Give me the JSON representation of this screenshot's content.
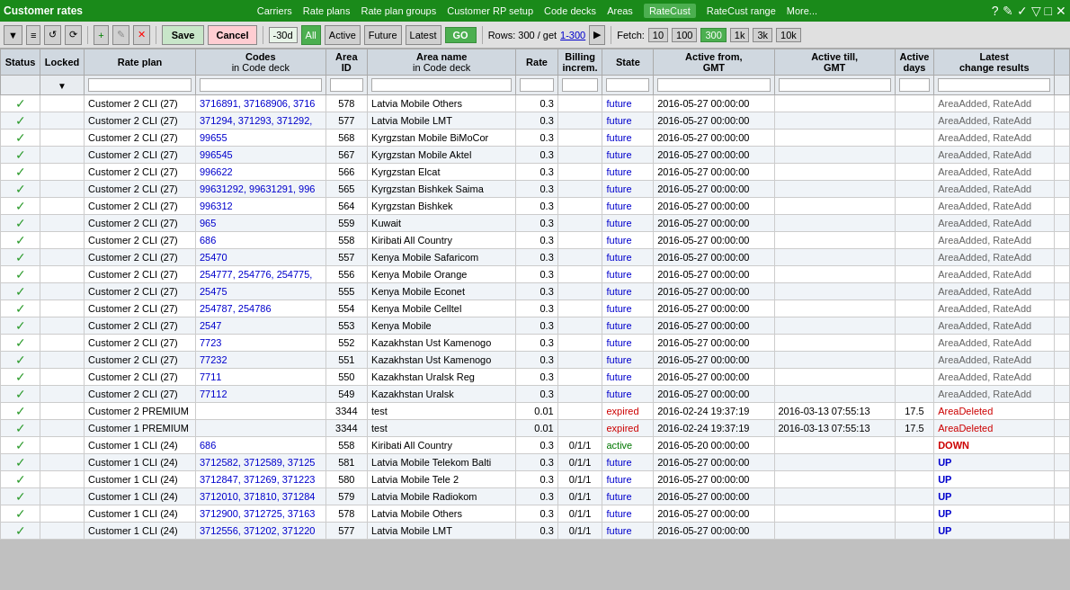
{
  "title": "Customer rates",
  "nav": {
    "items": [
      {
        "label": "Carriers",
        "active": false
      },
      {
        "label": "Rate plans",
        "active": false
      },
      {
        "label": "Rate plan groups",
        "active": false
      },
      {
        "label": "Customer RP setup",
        "active": false
      },
      {
        "label": "Code decks",
        "active": false
      },
      {
        "label": "Areas",
        "active": false
      },
      {
        "label": "RateCust",
        "active": true
      },
      {
        "label": "RateCust range",
        "active": false
      },
      {
        "label": "More...",
        "active": false
      }
    ]
  },
  "toolbar": {
    "save_label": "Save",
    "cancel_label": "Cancel",
    "go_label": "GO",
    "date_filter": "-30d",
    "filter_all": "All",
    "filter_active": "Active",
    "filter_future": "Future",
    "filter_latest": "Latest",
    "rows_info": "Rows: 300 / get",
    "rows_range": "1-300",
    "fetch_label": "Fetch:",
    "fetch_options": [
      "10",
      "100",
      "300",
      "1k",
      "3k",
      "10k"
    ],
    "fetch_active": "300"
  },
  "columns": [
    {
      "label": "Status",
      "sub": ""
    },
    {
      "label": "Locked",
      "sub": ""
    },
    {
      "label": "Rate plan",
      "sub": ""
    },
    {
      "label": "Codes",
      "sub": "in Code deck"
    },
    {
      "label": "Area\nID",
      "sub": ""
    },
    {
      "label": "Area name",
      "sub": "in Code deck"
    },
    {
      "label": "Rate",
      "sub": ""
    },
    {
      "label": "Billing\nincrem.",
      "sub": ""
    },
    {
      "label": "State",
      "sub": ""
    },
    {
      "label": "Active from,\nGMT",
      "sub": ""
    },
    {
      "label": "Active till,\nGMT",
      "sub": ""
    },
    {
      "label": "Active\ndays",
      "sub": ""
    },
    {
      "label": "Latest\nchange results",
      "sub": ""
    }
  ],
  "rows": [
    {
      "status": "✓",
      "locked": "",
      "rateplan": "Customer 2 CLI (27)",
      "codes": "3716891, 37168906, 3716",
      "area_id": "578",
      "area_name": "Latvia Mobile Others",
      "rate": "0.3",
      "billing": "",
      "state": "future",
      "active_from": "2016-05-27 00:00:00",
      "active_till": "",
      "days": "",
      "latest": "AreaAdded, RateAdd"
    },
    {
      "status": "✓",
      "locked": "",
      "rateplan": "Customer 2 CLI (27)",
      "codes": "371294, 371293, 371292,",
      "area_id": "577",
      "area_name": "Latvia Mobile LMT",
      "rate": "0.3",
      "billing": "",
      "state": "future",
      "active_from": "2016-05-27 00:00:00",
      "active_till": "",
      "days": "",
      "latest": "AreaAdded, RateAdd"
    },
    {
      "status": "✓",
      "locked": "",
      "rateplan": "Customer 2 CLI (27)",
      "codes": "99655",
      "area_id": "568",
      "area_name": "Kyrgzstan Mobile BiMoCor",
      "rate": "0.3",
      "billing": "",
      "state": "future",
      "active_from": "2016-05-27 00:00:00",
      "active_till": "",
      "days": "",
      "latest": "AreaAdded, RateAdd"
    },
    {
      "status": "✓",
      "locked": "",
      "rateplan": "Customer 2 CLI (27)",
      "codes": "996545",
      "area_id": "567",
      "area_name": "Kyrgzstan Mobile Aktel",
      "rate": "0.3",
      "billing": "",
      "state": "future",
      "active_from": "2016-05-27 00:00:00",
      "active_till": "",
      "days": "",
      "latest": "AreaAdded, RateAdd"
    },
    {
      "status": "✓",
      "locked": "",
      "rateplan": "Customer 2 CLI (27)",
      "codes": "996622",
      "area_id": "566",
      "area_name": "Kyrgzstan Elcat",
      "rate": "0.3",
      "billing": "",
      "state": "future",
      "active_from": "2016-05-27 00:00:00",
      "active_till": "",
      "days": "",
      "latest": "AreaAdded, RateAdd"
    },
    {
      "status": "✓",
      "locked": "",
      "rateplan": "Customer 2 CLI (27)",
      "codes": "99631292, 99631291, 996",
      "area_id": "565",
      "area_name": "Kyrgzstan Bishkek Saima",
      "rate": "0.3",
      "billing": "",
      "state": "future",
      "active_from": "2016-05-27 00:00:00",
      "active_till": "",
      "days": "",
      "latest": "AreaAdded, RateAdd"
    },
    {
      "status": "✓",
      "locked": "",
      "rateplan": "Customer 2 CLI (27)",
      "codes": "996312",
      "area_id": "564",
      "area_name": "Kyrgzstan Bishkek",
      "rate": "0.3",
      "billing": "",
      "state": "future",
      "active_from": "2016-05-27 00:00:00",
      "active_till": "",
      "days": "",
      "latest": "AreaAdded, RateAdd"
    },
    {
      "status": "✓",
      "locked": "",
      "rateplan": "Customer 2 CLI (27)",
      "codes": "965",
      "area_id": "559",
      "area_name": "Kuwait",
      "rate": "0.3",
      "billing": "",
      "state": "future",
      "active_from": "2016-05-27 00:00:00",
      "active_till": "",
      "days": "",
      "latest": "AreaAdded, RateAdd"
    },
    {
      "status": "✓",
      "locked": "",
      "rateplan": "Customer 2 CLI (27)",
      "codes": "686",
      "area_id": "558",
      "area_name": "Kiribati All Country",
      "rate": "0.3",
      "billing": "",
      "state": "future",
      "active_from": "2016-05-27 00:00:00",
      "active_till": "",
      "days": "",
      "latest": "AreaAdded, RateAdd"
    },
    {
      "status": "✓",
      "locked": "",
      "rateplan": "Customer 2 CLI (27)",
      "codes": "25470",
      "area_id": "557",
      "area_name": "Kenya Mobile Safaricom",
      "rate": "0.3",
      "billing": "",
      "state": "future",
      "active_from": "2016-05-27 00:00:00",
      "active_till": "",
      "days": "",
      "latest": "AreaAdded, RateAdd"
    },
    {
      "status": "✓",
      "locked": "",
      "rateplan": "Customer 2 CLI (27)",
      "codes": "254777, 254776, 254775,",
      "area_id": "556",
      "area_name": "Kenya Mobile Orange",
      "rate": "0.3",
      "billing": "",
      "state": "future",
      "active_from": "2016-05-27 00:00:00",
      "active_till": "",
      "days": "",
      "latest": "AreaAdded, RateAdd"
    },
    {
      "status": "✓",
      "locked": "",
      "rateplan": "Customer 2 CLI (27)",
      "codes": "25475",
      "area_id": "555",
      "area_name": "Kenya Mobile Econet",
      "rate": "0.3",
      "billing": "",
      "state": "future",
      "active_from": "2016-05-27 00:00:00",
      "active_till": "",
      "days": "",
      "latest": "AreaAdded, RateAdd"
    },
    {
      "status": "✓",
      "locked": "",
      "rateplan": "Customer 2 CLI (27)",
      "codes": "254787, 254786",
      "area_id": "554",
      "area_name": "Kenya Mobile Celltel",
      "rate": "0.3",
      "billing": "",
      "state": "future",
      "active_from": "2016-05-27 00:00:00",
      "active_till": "",
      "days": "",
      "latest": "AreaAdded, RateAdd"
    },
    {
      "status": "✓",
      "locked": "",
      "rateplan": "Customer 2 CLI (27)",
      "codes": "2547",
      "area_id": "553",
      "area_name": "Kenya Mobile",
      "rate": "0.3",
      "billing": "",
      "state": "future",
      "active_from": "2016-05-27 00:00:00",
      "active_till": "",
      "days": "",
      "latest": "AreaAdded, RateAdd"
    },
    {
      "status": "✓",
      "locked": "",
      "rateplan": "Customer 2 CLI (27)",
      "codes": "7723",
      "area_id": "552",
      "area_name": "Kazakhstan Ust Kamenogo",
      "rate": "0.3",
      "billing": "",
      "state": "future",
      "active_from": "2016-05-27 00:00:00",
      "active_till": "",
      "days": "",
      "latest": "AreaAdded, RateAdd"
    },
    {
      "status": "✓",
      "locked": "",
      "rateplan": "Customer 2 CLI (27)",
      "codes": "77232",
      "area_id": "551",
      "area_name": "Kazakhstan Ust Kamenogo",
      "rate": "0.3",
      "billing": "",
      "state": "future",
      "active_from": "2016-05-27 00:00:00",
      "active_till": "",
      "days": "",
      "latest": "AreaAdded, RateAdd"
    },
    {
      "status": "✓",
      "locked": "",
      "rateplan": "Customer 2 CLI (27)",
      "codes": "7711",
      "area_id": "550",
      "area_name": "Kazakhstan Uralsk Reg",
      "rate": "0.3",
      "billing": "",
      "state": "future",
      "active_from": "2016-05-27 00:00:00",
      "active_till": "",
      "days": "",
      "latest": "AreaAdded, RateAdd"
    },
    {
      "status": "✓",
      "locked": "",
      "rateplan": "Customer 2 CLI (27)",
      "codes": "77112",
      "area_id": "549",
      "area_name": "Kazakhstan Uralsk",
      "rate": "0.3",
      "billing": "",
      "state": "future",
      "active_from": "2016-05-27 00:00:00",
      "active_till": "",
      "days": "",
      "latest": "AreaAdded, RateAdd"
    },
    {
      "status": "✓",
      "locked": "",
      "rateplan": "Customer 2 PREMIUM",
      "codes": "",
      "area_id": "3344",
      "area_name": "test",
      "rate": "0.01",
      "billing": "",
      "state": "expired",
      "active_from": "2016-02-24 19:37:19",
      "active_till": "2016-03-13 07:55:13",
      "days": "17.5",
      "latest": "AreaDeleted"
    },
    {
      "status": "✓",
      "locked": "",
      "rateplan": "Customer 1 PREMIUM",
      "codes": "",
      "area_id": "3344",
      "area_name": "test",
      "rate": "0.01",
      "billing": "",
      "state": "expired",
      "active_from": "2016-02-24 19:37:19",
      "active_till": "2016-03-13 07:55:13",
      "days": "17.5",
      "latest": "AreaDeleted"
    },
    {
      "status": "✓",
      "locked": "",
      "rateplan": "Customer 1 CLI (24)",
      "codes": "686",
      "area_id": "558",
      "area_name": "Kiribati All Country",
      "rate": "0.3",
      "billing": "0/1/1",
      "state": "active",
      "active_from": "2016-05-20 00:00:00",
      "active_till": "",
      "days": "",
      "latest": "DOWN"
    },
    {
      "status": "✓",
      "locked": "",
      "rateplan": "Customer 1 CLI (24)",
      "codes": "3712582, 3712589, 37125",
      "area_id": "581",
      "area_name": "Latvia Mobile Telekom Balti",
      "rate": "0.3",
      "billing": "0/1/1",
      "state": "future",
      "active_from": "2016-05-27 00:00:00",
      "active_till": "",
      "days": "",
      "latest": "UP"
    },
    {
      "status": "✓",
      "locked": "",
      "rateplan": "Customer 1 CLI (24)",
      "codes": "3712847, 371269, 371223",
      "area_id": "580",
      "area_name": "Latvia Mobile Tele 2",
      "rate": "0.3",
      "billing": "0/1/1",
      "state": "future",
      "active_from": "2016-05-27 00:00:00",
      "active_till": "",
      "days": "",
      "latest": "UP"
    },
    {
      "status": "✓",
      "locked": "",
      "rateplan": "Customer 1 CLI (24)",
      "codes": "3712010, 371810, 371284",
      "area_id": "579",
      "area_name": "Latvia Mobile Radiokom",
      "rate": "0.3",
      "billing": "0/1/1",
      "state": "future",
      "active_from": "2016-05-27 00:00:00",
      "active_till": "",
      "days": "",
      "latest": "UP"
    },
    {
      "status": "✓",
      "locked": "",
      "rateplan": "Customer 1 CLI (24)",
      "codes": "3712900, 3712725, 37163",
      "area_id": "578",
      "area_name": "Latvia Mobile Others",
      "rate": "0.3",
      "billing": "0/1/1",
      "state": "future",
      "active_from": "2016-05-27 00:00:00",
      "active_till": "",
      "days": "",
      "latest": "UP"
    },
    {
      "status": "✓",
      "locked": "",
      "rateplan": "Customer 1 CLI (24)",
      "codes": "3712556, 371202, 371220",
      "area_id": "577",
      "area_name": "Latvia Mobile LMT",
      "rate": "0.3",
      "billing": "0/1/1",
      "state": "future",
      "active_from": "2016-05-27 00:00:00",
      "active_till": "",
      "days": "",
      "latest": "UP"
    }
  ]
}
